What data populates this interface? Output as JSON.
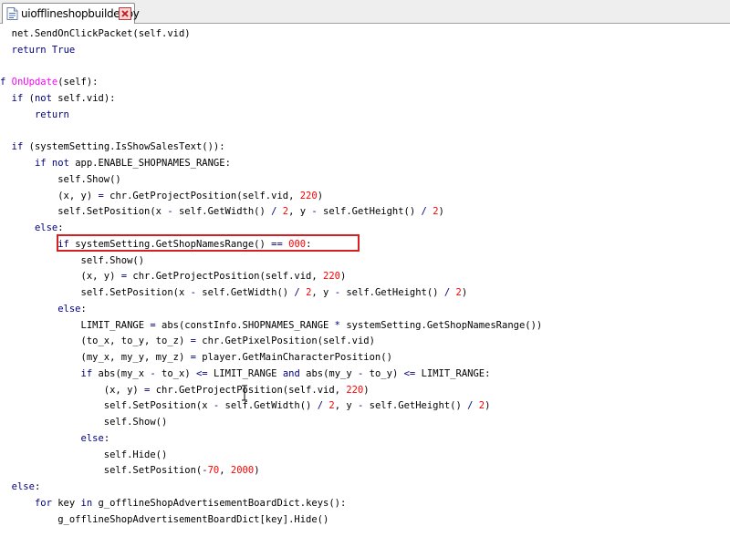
{
  "tab": {
    "title": "uiofflineshopbuilder.py",
    "file_icon": "python-file-icon",
    "close_icon": "close-icon"
  },
  "code_lines": [
    [
      {
        "t": "  net.SendOnClickPacket(self.vid)"
      }
    ],
    [
      {
        "t": "  "
      },
      {
        "t": "return",
        "c": "kw"
      },
      {
        "t": " "
      },
      {
        "t": "True",
        "c": "kw"
      }
    ],
    [
      {
        "t": ""
      }
    ],
    [
      {
        "t": "f",
        "c": "kw"
      },
      {
        "t": " "
      },
      {
        "t": "OnUpdate",
        "c": "fn"
      },
      {
        "t": "(self):"
      }
    ],
    [
      {
        "t": "  "
      },
      {
        "t": "if",
        "c": "kw"
      },
      {
        "t": " ("
      },
      {
        "t": "not",
        "c": "kw"
      },
      {
        "t": " self.vid):"
      }
    ],
    [
      {
        "t": "      "
      },
      {
        "t": "return",
        "c": "kw"
      }
    ],
    [
      {
        "t": ""
      }
    ],
    [
      {
        "t": "  "
      },
      {
        "t": "if",
        "c": "kw"
      },
      {
        "t": " (systemSetting.IsShowSalesText()):"
      }
    ],
    [
      {
        "t": "      "
      },
      {
        "t": "if",
        "c": "kw"
      },
      {
        "t": " "
      },
      {
        "t": "not",
        "c": "kw"
      },
      {
        "t": " app.ENABLE_SHOPNAMES_RANGE:"
      }
    ],
    [
      {
        "t": "          self.Show()"
      }
    ],
    [
      {
        "t": "          (x, y) "
      },
      {
        "t": "=",
        "c": "op"
      },
      {
        "t": " chr.GetProjectPosition(self.vid, "
      },
      {
        "t": "220",
        "c": "num"
      },
      {
        "t": ")"
      }
    ],
    [
      {
        "t": "          self.SetPosition(x "
      },
      {
        "t": "-",
        "c": "op"
      },
      {
        "t": " self.GetWidth() "
      },
      {
        "t": "/",
        "c": "op"
      },
      {
        "t": " "
      },
      {
        "t": "2",
        "c": "num"
      },
      {
        "t": ", y "
      },
      {
        "t": "-",
        "c": "op"
      },
      {
        "t": " self.GetHeight() "
      },
      {
        "t": "/",
        "c": "op"
      },
      {
        "t": " "
      },
      {
        "t": "2",
        "c": "num"
      },
      {
        "t": ")"
      }
    ],
    [
      {
        "t": "      "
      },
      {
        "t": "else",
        "c": "kw"
      },
      {
        "t": ":"
      }
    ],
    [
      {
        "t": "          "
      },
      {
        "t": "if",
        "c": "kw"
      },
      {
        "t": " systemSetting.GetShopNamesRange() "
      },
      {
        "t": "==",
        "c": "op"
      },
      {
        "t": " "
      },
      {
        "t": "000",
        "c": "num"
      },
      {
        "t": ":"
      }
    ],
    [
      {
        "t": "              self.Show()"
      }
    ],
    [
      {
        "t": "              (x, y) "
      },
      {
        "t": "=",
        "c": "op"
      },
      {
        "t": " chr.GetProjectPosition(self.vid, "
      },
      {
        "t": "220",
        "c": "num"
      },
      {
        "t": ")"
      }
    ],
    [
      {
        "t": "              self.SetPosition(x "
      },
      {
        "t": "-",
        "c": "op"
      },
      {
        "t": " self.GetWidth() "
      },
      {
        "t": "/",
        "c": "op"
      },
      {
        "t": " "
      },
      {
        "t": "2",
        "c": "num"
      },
      {
        "t": ", y "
      },
      {
        "t": "-",
        "c": "op"
      },
      {
        "t": " self.GetHeight() "
      },
      {
        "t": "/",
        "c": "op"
      },
      {
        "t": " "
      },
      {
        "t": "2",
        "c": "num"
      },
      {
        "t": ")"
      }
    ],
    [
      {
        "t": "          "
      },
      {
        "t": "else",
        "c": "kw"
      },
      {
        "t": ":"
      }
    ],
    [
      {
        "t": "              LIMIT_RANGE "
      },
      {
        "t": "=",
        "c": "op"
      },
      {
        "t": " abs(constInfo.SHOPNAMES_RANGE "
      },
      {
        "t": "*",
        "c": "op"
      },
      {
        "t": " systemSetting.GetShopNamesRange())"
      }
    ],
    [
      {
        "t": "              (to_x, to_y, to_z) "
      },
      {
        "t": "=",
        "c": "op"
      },
      {
        "t": " chr.GetPixelPosition(self.vid)"
      }
    ],
    [
      {
        "t": "              (my_x, my_y, my_z) "
      },
      {
        "t": "=",
        "c": "op"
      },
      {
        "t": " player.GetMainCharacterPosition()"
      }
    ],
    [
      {
        "t": "              "
      },
      {
        "t": "if",
        "c": "kw"
      },
      {
        "t": " abs(my_x "
      },
      {
        "t": "-",
        "c": "op"
      },
      {
        "t": " to_x) "
      },
      {
        "t": "<=",
        "c": "op"
      },
      {
        "t": " LIMIT_RANGE "
      },
      {
        "t": "and",
        "c": "kw"
      },
      {
        "t": " abs(my_y "
      },
      {
        "t": "-",
        "c": "op"
      },
      {
        "t": " to_y) "
      },
      {
        "t": "<=",
        "c": "op"
      },
      {
        "t": " LIMIT_RANGE:"
      }
    ],
    [
      {
        "t": "                  (x, y) "
      },
      {
        "t": "=",
        "c": "op"
      },
      {
        "t": " chr.GetProjectPosition(self.vid, "
      },
      {
        "t": "220",
        "c": "num"
      },
      {
        "t": ")"
      }
    ],
    [
      {
        "t": "                  self.SetPosition(x "
      },
      {
        "t": "-",
        "c": "op"
      },
      {
        "t": " self.GetWidth() "
      },
      {
        "t": "/",
        "c": "op"
      },
      {
        "t": " "
      },
      {
        "t": "2",
        "c": "num"
      },
      {
        "t": ", y "
      },
      {
        "t": "-",
        "c": "op"
      },
      {
        "t": " self.GetHeight() "
      },
      {
        "t": "/",
        "c": "op"
      },
      {
        "t": " "
      },
      {
        "t": "2",
        "c": "num"
      },
      {
        "t": ")"
      }
    ],
    [
      {
        "t": "                  self.Show()"
      }
    ],
    [
      {
        "t": "              "
      },
      {
        "t": "else",
        "c": "kw"
      },
      {
        "t": ":"
      }
    ],
    [
      {
        "t": "                  self.Hide()"
      }
    ],
    [
      {
        "t": "                  self.SetPosition("
      },
      {
        "t": "-",
        "c": "op"
      },
      {
        "t": "70",
        "c": "num"
      },
      {
        "t": ", "
      },
      {
        "t": "2000",
        "c": "num"
      },
      {
        "t": ")"
      }
    ],
    [
      {
        "t": "  "
      },
      {
        "t": "else",
        "c": "kw"
      },
      {
        "t": ":"
      }
    ],
    [
      {
        "t": "      "
      },
      {
        "t": "for",
        "c": "kw"
      },
      {
        "t": " key "
      },
      {
        "t": "in",
        "c": "kw"
      },
      {
        "t": " g_offlineShopAdvertisementBoardDict.keys():"
      }
    ],
    [
      {
        "t": "          g_offlineShopAdvertisementBoardDict[key].Hide()"
      }
    ]
  ],
  "highlight": {
    "line_index": 13,
    "color": "#d42020"
  },
  "colors": {
    "keyword": "#000080",
    "function_name": "#ff00ff",
    "number": "#ff0000",
    "text": "#000000",
    "background": "#ffffff"
  }
}
